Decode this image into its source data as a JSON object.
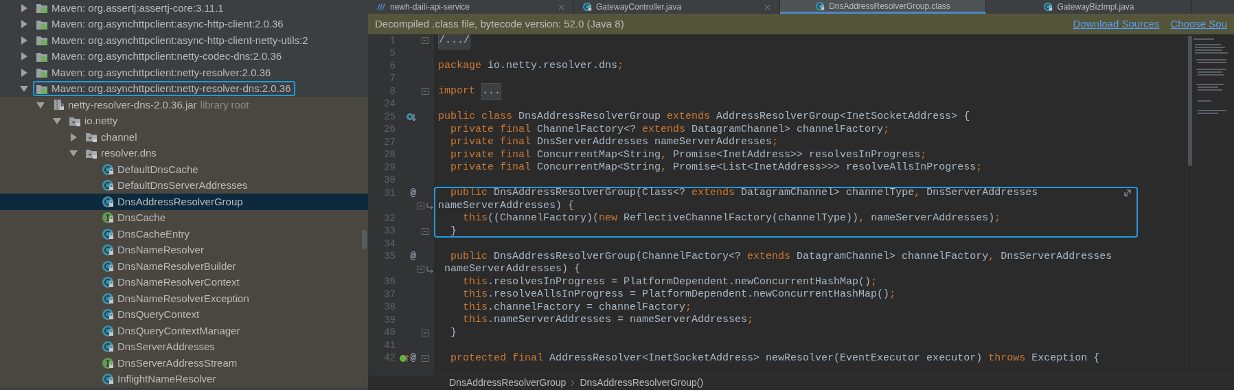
{
  "project_tree": {
    "items": [
      {
        "kind": "library",
        "label": "Maven: org.assertj:assertj-core:3.11.1",
        "expanded": false,
        "selected": false,
        "outlined": false
      },
      {
        "kind": "library",
        "label": "Maven: org.asynchttpclient:async-http-client:2.0.36",
        "expanded": false,
        "selected": false,
        "outlined": false
      },
      {
        "kind": "library",
        "label": "Maven: org.asynchttpclient:async-http-client-netty-utils:2",
        "expanded": false,
        "selected": false,
        "outlined": false
      },
      {
        "kind": "library",
        "label": "Maven: org.asynchttpclient:netty-codec-dns:2.0.36",
        "expanded": false,
        "selected": false,
        "outlined": false
      },
      {
        "kind": "library",
        "label": "Maven: org.asynchttpclient:netty-resolver:2.0.36",
        "expanded": false,
        "selected": false,
        "outlined": false
      },
      {
        "kind": "library",
        "label": "Maven: org.asynchttpclient:netty-resolver-dns:2.0.36",
        "expanded": true,
        "selected": false,
        "outlined": true,
        "children": [
          {
            "kind": "jar",
            "label": "netty-resolver-dns-2.0.36.jar",
            "note": "library root",
            "expanded": true,
            "selected": false,
            "outlined": false,
            "children": [
              {
                "kind": "package",
                "label": "io.netty",
                "expanded": true,
                "selected": false,
                "outlined": false,
                "children": [
                  {
                    "kind": "package",
                    "label": "channel",
                    "expanded": false,
                    "selected": false,
                    "outlined": false
                  },
                  {
                    "kind": "package",
                    "label": "resolver.dns",
                    "expanded": true,
                    "selected": false,
                    "outlined": false,
                    "children": [
                      {
                        "kind": "class",
                        "label": "DefaultDnsCache",
                        "selected": false,
                        "outlined": false
                      },
                      {
                        "kind": "class",
                        "label": "DefaultDnsServerAddresses",
                        "selected": false,
                        "outlined": false
                      },
                      {
                        "kind": "class",
                        "label": "DnsAddressResolverGroup",
                        "selected": true,
                        "outlined": false
                      },
                      {
                        "kind": "interface",
                        "label": "DnsCache",
                        "selected": false,
                        "outlined": false
                      },
                      {
                        "kind": "class",
                        "label": "DnsCacheEntry",
                        "selected": false,
                        "outlined": false
                      },
                      {
                        "kind": "class",
                        "label": "DnsNameResolver",
                        "selected": false,
                        "outlined": false
                      },
                      {
                        "kind": "class",
                        "label": "DnsNameResolverBuilder",
                        "selected": false,
                        "outlined": false
                      },
                      {
                        "kind": "class",
                        "label": "DnsNameResolverContext",
                        "selected": false,
                        "outlined": false
                      },
                      {
                        "kind": "class",
                        "label": "DnsNameResolverException",
                        "selected": false,
                        "outlined": false
                      },
                      {
                        "kind": "class",
                        "label": "DnsQueryContext",
                        "selected": false,
                        "outlined": false
                      },
                      {
                        "kind": "class",
                        "label": "DnsQueryContextManager",
                        "selected": false,
                        "outlined": false
                      },
                      {
                        "kind": "class",
                        "label": "DnsServerAddresses",
                        "selected": false,
                        "outlined": false
                      },
                      {
                        "kind": "interface",
                        "label": "DnsServerAddressStream",
                        "selected": false,
                        "outlined": false
                      },
                      {
                        "kind": "class",
                        "label": "InflightNameResolver",
                        "selected": false,
                        "outlined": false
                      }
                    ]
                  }
                ]
              }
            ]
          }
        ]
      }
    ]
  },
  "editor_tabs": [
    {
      "kind": "module",
      "label": "newh-daili-api-service",
      "selected": false,
      "close_button": true
    },
    {
      "kind": "class",
      "label": "GatewayController.java",
      "selected": false,
      "close_button": true
    },
    {
      "kind": "class",
      "label": "DnsAddressResolverGroup.class",
      "selected": true,
      "close_button": false
    },
    {
      "kind": "class",
      "label": "GatewayBizImpl.java",
      "selected": false,
      "close_button": false
    }
  ],
  "banner": {
    "text": "Decompiled .class file, bytecode version: 52.0 (Java 8)",
    "links": [
      "Download Sources",
      "Choose Sou"
    ]
  },
  "code_lines": [
    {
      "kind": "line",
      "number": "1",
      "fold": true,
      "tokens": [
        {
          "kind": "folded",
          "text": "/.../"
        }
      ]
    },
    {
      "kind": "line",
      "number": "5",
      "fold": false
    },
    {
      "kind": "line",
      "number": "6",
      "fold": false,
      "tokens": [
        {
          "kind": "keyword",
          "text": "package"
        },
        {
          "kind": "plain",
          "text": " io.netty.resolver.dns"
        },
        {
          "kind": "keyword",
          "text": ";"
        }
      ]
    },
    {
      "kind": "line",
      "number": "7",
      "fold": false
    },
    {
      "kind": "line",
      "number": "8",
      "fold": true,
      "tokens": [
        {
          "kind": "keyword",
          "text": "import "
        },
        {
          "kind": "folded",
          "text": "..."
        }
      ]
    },
    {
      "kind": "line",
      "number": "24",
      "fold": false
    },
    {
      "kind": "line",
      "number": "25",
      "fold": false,
      "gutter": {
        "kind": "overridden"
      },
      "tokens": [
        {
          "kind": "keyword",
          "text": "public class"
        },
        {
          "kind": "plain",
          "text": " DnsAddressResolverGroup "
        },
        {
          "kind": "keyword",
          "text": "extends"
        },
        {
          "kind": "plain",
          "text": " AddressResolverGroup<InetSocketAddress> {"
        }
      ]
    },
    {
      "kind": "line",
      "number": "26",
      "fold": false,
      "tokens": [
        {
          "kind": "keyword",
          "text": "  private final"
        },
        {
          "kind": "plain",
          "text": " ChannelFactory<? "
        },
        {
          "kind": "keyword",
          "text": "extends"
        },
        {
          "kind": "plain",
          "text": " DatagramChannel> channelFactory"
        },
        {
          "kind": "keyword",
          "text": ";"
        }
      ]
    },
    {
      "kind": "line",
      "number": "27",
      "fold": false,
      "tokens": [
        {
          "kind": "keyword",
          "text": "  private final"
        },
        {
          "kind": "plain",
          "text": " DnsServerAddresses nameServerAddresses"
        },
        {
          "kind": "keyword",
          "text": ";"
        }
      ]
    },
    {
      "kind": "line",
      "number": "28",
      "fold": false,
      "tokens": [
        {
          "kind": "keyword",
          "text": "  private final"
        },
        {
          "kind": "plain",
          "text": " ConcurrentMap<String"
        },
        {
          "kind": "keyword",
          "text": ","
        },
        {
          "kind": "plain",
          "text": " Promise<InetAddress>> resolvesInProgress"
        },
        {
          "kind": "keyword",
          "text": ";"
        }
      ]
    },
    {
      "kind": "line",
      "number": "29",
      "fold": false,
      "tokens": [
        {
          "kind": "keyword",
          "text": "  private final"
        },
        {
          "kind": "plain",
          "text": " ConcurrentMap<String"
        },
        {
          "kind": "keyword",
          "text": ","
        },
        {
          "kind": "plain",
          "text": " Promise<List<InetAddress>>> resolveAllsInProgress"
        },
        {
          "kind": "keyword",
          "text": ";"
        }
      ]
    },
    {
      "kind": "line",
      "number": "30",
      "fold": false
    },
    {
      "kind": "box",
      "lines": [
        {
          "kind": "line",
          "number": "31",
          "fold": false,
          "annotation": "@",
          "wrapped": true,
          "tokens": [
            {
              "kind": "keyword",
              "text": "  public"
            },
            {
              "kind": "plain",
              "text": " DnsAddressResolverGroup(Class<? "
            },
            {
              "kind": "keyword",
              "text": "extends"
            },
            {
              "kind": "plain",
              "text": " DatagramChannel> channelType"
            },
            {
              "kind": "keyword",
              "text": ","
            },
            {
              "kind": "plain",
              "text": " DnsServerAddresses"
            }
          ]
        },
        {
          "kind": "continuation",
          "fold": true,
          "tokens": [
            {
              "kind": "plain",
              "text": "nameServerAddresses) {"
            }
          ]
        },
        {
          "kind": "line",
          "number": "32",
          "fold": false,
          "tokens": [
            {
              "kind": "keyword",
              "text": "    this"
            },
            {
              "kind": "plain",
              "text": "((ChannelFactory)("
            },
            {
              "kind": "keyword",
              "text": "new"
            },
            {
              "kind": "plain",
              "text": " ReflectiveChannelFactory(channelType))"
            },
            {
              "kind": "keyword",
              "text": ","
            },
            {
              "kind": "plain",
              "text": " nameServerAddresses)"
            },
            {
              "kind": "keyword",
              "text": ";"
            }
          ]
        },
        {
          "kind": "line",
          "number": "33",
          "fold": true,
          "tokens": [
            {
              "kind": "plain",
              "text": "  }"
            }
          ]
        }
      ]
    },
    {
      "kind": "line",
      "number": "34",
      "fold": false
    },
    {
      "kind": "line",
      "number": "35",
      "fold": false,
      "annotation": "@",
      "tokens": [
        {
          "kind": "keyword",
          "text": "  public"
        },
        {
          "kind": "plain",
          "text": " DnsAddressResolverGroup(ChannelFactory<? "
        },
        {
          "kind": "keyword",
          "text": "extends"
        },
        {
          "kind": "plain",
          "text": " DatagramChannel> channelFactory"
        },
        {
          "kind": "keyword",
          "text": ","
        },
        {
          "kind": "plain",
          "text": " DnsServerAddresses"
        }
      ]
    },
    {
      "kind": "continuation",
      "fold": true,
      "tokens": [
        {
          "kind": "plain",
          "text": " nameServerAddresses) {"
        }
      ]
    },
    {
      "kind": "line",
      "number": "36",
      "fold": false,
      "tokens": [
        {
          "kind": "keyword",
          "text": "    this"
        },
        {
          "kind": "plain",
          "text": ".resolvesInProgress = PlatformDependent.newConcurrentHashMap()"
        },
        {
          "kind": "keyword",
          "text": ";"
        }
      ]
    },
    {
      "kind": "line",
      "number": "37",
      "fold": false,
      "tokens": [
        {
          "kind": "keyword",
          "text": "    this"
        },
        {
          "kind": "plain",
          "text": ".resolveAllsInProgress = PlatformDependent.newConcurrentHashMap()"
        },
        {
          "kind": "keyword",
          "text": ";"
        }
      ]
    },
    {
      "kind": "line",
      "number": "38",
      "fold": false,
      "tokens": [
        {
          "kind": "keyword",
          "text": "    this"
        },
        {
          "kind": "plain",
          "text": ".channelFactory = channelFactory"
        },
        {
          "kind": "keyword",
          "text": ";"
        }
      ]
    },
    {
      "kind": "line",
      "number": "39",
      "fold": false,
      "tokens": [
        {
          "kind": "keyword",
          "text": "    this"
        },
        {
          "kind": "plain",
          "text": ".nameServerAddresses = nameServerAddresses"
        },
        {
          "kind": "keyword",
          "text": ";"
        }
      ]
    },
    {
      "kind": "line",
      "number": "40",
      "fold": true,
      "tokens": [
        {
          "kind": "plain",
          "text": "  }"
        }
      ]
    },
    {
      "kind": "line",
      "number": "41",
      "fold": false
    },
    {
      "kind": "line",
      "number": "42",
      "fold": true,
      "gutter": {
        "kind": "implements"
      },
      "annotation": "@",
      "tokens": [
        {
          "kind": "keyword",
          "text": "  protected final"
        },
        {
          "kind": "plain",
          "text": " AddressResolver<InetSocketAddress> newResolver(EventExecutor executor) "
        },
        {
          "kind": "keyword",
          "text": "throws"
        },
        {
          "kind": "plain",
          "text": " Exception {"
        }
      ]
    }
  ],
  "breadcrumbs": [
    "DnsAddressResolverGroup",
    "DnsAddressResolverGroup()"
  ]
}
